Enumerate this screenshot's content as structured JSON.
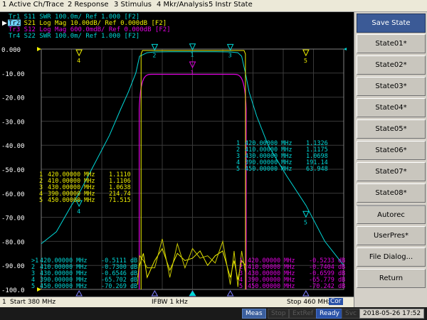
{
  "menu": [
    {
      "label": "1 Active Ch/Trace"
    },
    {
      "label": "2 Response"
    },
    {
      "label": "3 Stimulus"
    },
    {
      "label": "4 Mkr/Analysis"
    },
    {
      "label": "5 Instr State"
    }
  ],
  "traces": [
    {
      "label": "Tr1  S11  SWR 100.0m/ Ref 1.000  [F2]",
      "color": "#00d8d8"
    },
    {
      "label": "Tr2  S21  Log Mag 10.00dB/ Ref 0.000dB  [F2]",
      "color": "#f0f000"
    },
    {
      "label": "Tr3  S12  Log Mag 600.0mdB/ Ref 0.000dB  [F2]",
      "color": "#e000e0"
    },
    {
      "label": "Tr4  S22  SWR 100.0m/ Ref 1.000  [F2]",
      "color": "#00d8d8"
    }
  ],
  "active_trace_tag": "Tr2",
  "y_ticks": [
    "0.000",
    "-10.00",
    "-20.00",
    "-30.00",
    "-40.00",
    "-50.00",
    "-60.00",
    "-70.00",
    "-80.00",
    "-90.00",
    "-100.0"
  ],
  "marker_table_cyan": [
    {
      "num": "1",
      "freq": "420.00000 MHz",
      "val": "1.1326"
    },
    {
      "num": "2",
      "freq": "410.00000 MHz",
      "val": "1.1175"
    },
    {
      "num": "3",
      "freq": "430.00000 MHz",
      "val": "1.0698"
    },
    {
      "num": "4",
      "freq": "390.00000 MHz",
      "val": "191.14"
    },
    {
      "num": "5",
      "freq": "450.00000 MHz",
      "val": "63.948"
    }
  ],
  "marker_table_yellow": [
    {
      "num": "1",
      "freq": "420.00000 MHz",
      "val": "1.1110"
    },
    {
      "num": "2",
      "freq": "410.00000 MHz",
      "val": "1.1106"
    },
    {
      "num": "3",
      "freq": "430.00000 MHz",
      "val": "1.0638"
    },
    {
      "num": "4",
      "freq": "390.00000 MHz",
      "val": "214.74"
    },
    {
      "num": "5",
      "freq": "450.00000 MHz",
      "val": "71.515"
    }
  ],
  "marker_table_s21": [
    {
      "num": ">1",
      "freq": "420.00000 MHz",
      "val": "-0.5111 dB"
    },
    {
      "num": "2",
      "freq": "410.00000 MHz",
      "val": "-0.7300 dB"
    },
    {
      "num": "3",
      "freq": "430.00000 MHz",
      "val": "-0.6546 dB"
    },
    {
      "num": "4",
      "freq": "390.00000 MHz",
      "val": "-65.702 dB"
    },
    {
      "num": "5",
      "freq": "450.00000 MHz",
      "val": "-70.269 dB"
    }
  ],
  "marker_table_s12": [
    {
      "num": "1",
      "freq": "420.00000 MHz",
      "val": "-0.5233 dB"
    },
    {
      "num": "2",
      "freq": "410.00000 MHz",
      "val": "-0.7404 dB"
    },
    {
      "num": "3",
      "freq": "430.00000 MHz",
      "val": "-0.6599 dB"
    },
    {
      "num": "4",
      "freq": "390.00000 MHz",
      "val": "-65.779 dB"
    },
    {
      "num": "5",
      "freq": "450.00000 MHz",
      "val": "-70.242 dB"
    }
  ],
  "stimulus": {
    "channel": "1",
    "start": "Start 380 MHz",
    "ifbw": "IFBW 1 kHz",
    "stop": "Stop 460 MHz",
    "cor": "Cor"
  },
  "status": {
    "meas": "Meas",
    "stop": "Stop",
    "extref": "ExtRef",
    "ready": "Ready",
    "svc": "Svc",
    "datetime": "2018-05-26 17:52"
  },
  "softkeys": [
    {
      "label": "Save State"
    },
    {
      "label": "State01*"
    },
    {
      "label": "State02*"
    },
    {
      "label": "State03*"
    },
    {
      "label": "State04*"
    },
    {
      "label": "State05*"
    },
    {
      "label": "State06*"
    },
    {
      "label": "State07*"
    },
    {
      "label": "State08*"
    },
    {
      "label": "Autorec"
    },
    {
      "label": "UserPres*"
    },
    {
      "label": "File Dialog..."
    },
    {
      "label": "Return"
    }
  ],
  "chart_data": {
    "type": "line",
    "x_unit": "MHz",
    "xlim": [
      380,
      460
    ],
    "ylim_s21": [
      -100,
      0
    ],
    "grid": true,
    "series": [
      {
        "name": "S11",
        "color": "#00d8d8",
        "x": [
          380,
          384,
          388,
          390,
          394,
          398,
          401,
          403,
          405,
          406,
          408,
          410,
          414,
          418,
          420,
          422,
          426,
          430,
          432,
          433,
          434,
          435,
          437,
          440,
          445,
          450,
          455,
          460
        ],
        "y": [
          -81,
          -76,
          -65,
          -60,
          -48,
          -36,
          -25,
          -18,
          -10,
          -3,
          -1.5,
          -1.2,
          -1.1,
          -1.1,
          -1.1,
          -1.1,
          -1.1,
          -1.2,
          -1.5,
          -3,
          -10,
          -18,
          -28,
          -40,
          -53,
          -65,
          -80,
          -90
        ]
      },
      {
        "name": "S21",
        "color": "#f0f000",
        "x": [
          405.5,
          406,
          407,
          408,
          410,
          412,
          414,
          416,
          418,
          420,
          422,
          424,
          426,
          428,
          430,
          431,
          432,
          433,
          434
        ],
        "y": [
          -95,
          -90,
          -85,
          -95,
          -88,
          -83,
          -92,
          -85,
          -88,
          -87,
          -84,
          -90,
          -86,
          -84,
          -95,
          -88,
          -96,
          -88,
          -90
        ]
      },
      {
        "name": "S12",
        "color": "#e000e0",
        "x": [
          405,
          405.8,
          406.2,
          407,
          409,
          412,
          -1
        ],
        "y": [
          -100,
          -90,
          -25,
          -14,
          -11,
          -9.5,
          0
        ]
      }
    ]
  }
}
